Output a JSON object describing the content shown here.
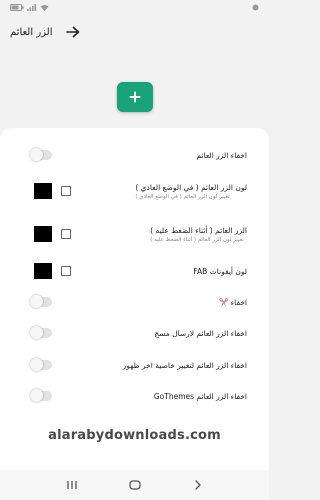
{
  "statusbar": {
    "time": "",
    "battery": ""
  },
  "header": {
    "title": "الزر العائم"
  },
  "settings": [
    {
      "type": "toggle",
      "title": "اخفاء الزر العائم",
      "on": false
    },
    {
      "type": "color",
      "title": "لون الزر العائم ( في الوضع العادي )",
      "subtitle": "تغيير لون الزر العائم ( في الوضع العادي )",
      "color": "#000000",
      "checked": false
    },
    {
      "type": "color",
      "title": "الزر العائم ( أثناء الضغط عليه )",
      "subtitle": "تغيير لون الزر العائم ( أثناء الضغط عليه )",
      "color": "#000000",
      "checked": false
    },
    {
      "type": "color",
      "title": "لون أيقونات FAB",
      "subtitle": "",
      "color": "#000000",
      "checked": false
    },
    {
      "type": "toggle",
      "title": "اخفاء ✂️",
      "on": false
    },
    {
      "type": "toggle",
      "title": "اخفاء الزر العائم لارسال مسج",
      "on": false
    },
    {
      "type": "toggle",
      "title": "اخفاء الزر العائم لتغيير خاصية اخر ظهور",
      "on": false
    },
    {
      "type": "toggle",
      "title": "اخفاء الزر العائم GoThemes",
      "on": false
    }
  ],
  "watermark": "alarabydownloads.com",
  "colors": {
    "fab": "#1aa37a",
    "background": "#f2f2f2",
    "card": "#ffffff"
  },
  "icons": {
    "back": "arrow-right-icon",
    "fab": "plus-icon",
    "nav": [
      "recents-icon",
      "home-icon",
      "back-icon"
    ]
  }
}
